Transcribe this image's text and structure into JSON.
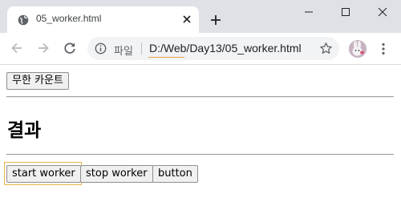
{
  "browser": {
    "tab_title": "05_worker.html",
    "scheme_label": "파일",
    "url": "D:/Web/Day13/05_worker.html"
  },
  "page": {
    "count_button": "무한 카운트",
    "result_heading": "결과",
    "start_button": "start worker",
    "stop_button": "stop worker",
    "plain_button": "button"
  }
}
